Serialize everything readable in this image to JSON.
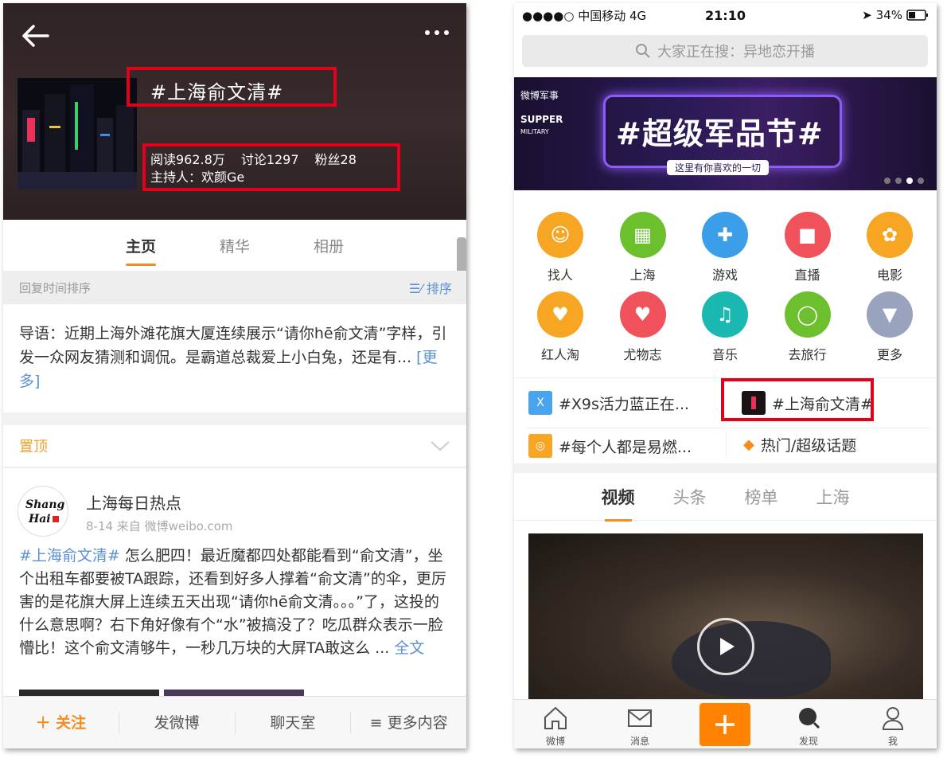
{
  "left": {
    "topic_title": "#上海俞文清#",
    "stats": {
      "reads": "阅读962.8万",
      "discussions": "讨论1297",
      "fans": "粉丝28"
    },
    "host": "主持人：欢颜Ge",
    "tabs": [
      {
        "label": "主页",
        "active": true
      },
      {
        "label": "精华"
      },
      {
        "label": "相册"
      }
    ],
    "sort_bar": {
      "label": "回复时间排序",
      "sort": "☰⁄ 排序"
    },
    "lead": {
      "text": "导语：近期上海外滩花旗大厦连续展示“请你hē俞文清”字样，引发一众网友猜测和调侃。是霸道总裁爱上小白兔，还是有...",
      "more": "[更多]"
    },
    "pinned_label": "置顶",
    "post": {
      "author": "上海每日热点",
      "meta": "8-14  来自 微博weibo.com",
      "hashtag": "#上海俞文清#",
      "body": " 怎么肥四！最近魔都四处都能看到“俞文清”，坐个出租车都要被TA跟踪，还看到好多人撑着“俞文清”的伞，更厉害的是花旗大屏上连续五天出现“请你hē俞文清。。。”了，这投的什么意思啊？右下角好像有个“水”被搞没了？吃瓜群众表示一脸懵比！这个俞文清够牛，一秒几万块的大屏TA敢这么 ... ",
      "full": "全文"
    },
    "avatar_text": {
      "line1": "Shang",
      "line2": "Hai"
    },
    "bottom": {
      "follow": "＋ 关注",
      "post": "发微博",
      "chat": "聊天室",
      "more": "≡ 更多内容"
    }
  },
  "right": {
    "status": {
      "carrier": "●●●●○ 中国移动  4G",
      "time": "21:10",
      "battery": "34%"
    },
    "search_placeholder": "大家正在搜：异地恋开播",
    "banner": {
      "brand": "微博军事",
      "supper": "SUPPER",
      "military": "MILITARY",
      "title": "#超级军品节#",
      "subtitle": "这里有你喜欢的一切"
    },
    "grid": [
      {
        "label": "找人",
        "color": "#f6a623",
        "icon": "person-icon"
      },
      {
        "label": "上海",
        "color": "#6cc02e",
        "icon": "city-icon"
      },
      {
        "label": "游戏",
        "color": "#3a9ee8",
        "icon": "gamepad-icon"
      },
      {
        "label": "直播",
        "color": "#f0525b",
        "icon": "video-camera-icon"
      },
      {
        "label": "电影",
        "color": "#f6a623",
        "icon": "film-reel-icon"
      },
      {
        "label": "红人淘",
        "color": "#f6a623",
        "icon": "shopping-bag-icon"
      },
      {
        "label": "尤物志",
        "color": "#f0525b",
        "icon": "heart-icon"
      },
      {
        "label": "音乐",
        "color": "#19b8b0",
        "icon": "music-note-icon"
      },
      {
        "label": "去旅行",
        "color": "#6cc02e",
        "icon": "balloon-icon"
      },
      {
        "label": "更多",
        "color": "#9aa3bd",
        "icon": "chevron-down-icon"
      }
    ],
    "hot_topics": [
      {
        "label": "#X9s活力蓝正在...",
        "badge": "X",
        "color": "#4aa3ee"
      },
      {
        "label": "#上海俞文清#",
        "badge": "",
        "color": "#222"
      },
      {
        "label": "#每个人都是易燃...",
        "badge": "",
        "color": "#f6a623"
      },
      {
        "label": "热门/超级话题",
        "badge": "◆",
        "color": "#f78b1f"
      }
    ],
    "tabs": [
      {
        "label": "视频",
        "active": true
      },
      {
        "label": "头条"
      },
      {
        "label": "榜单"
      },
      {
        "label": "上海"
      }
    ],
    "tabbar": [
      {
        "label": "微博"
      },
      {
        "label": "消息"
      },
      {
        "label": "发现"
      },
      {
        "label": "我"
      }
    ]
  }
}
